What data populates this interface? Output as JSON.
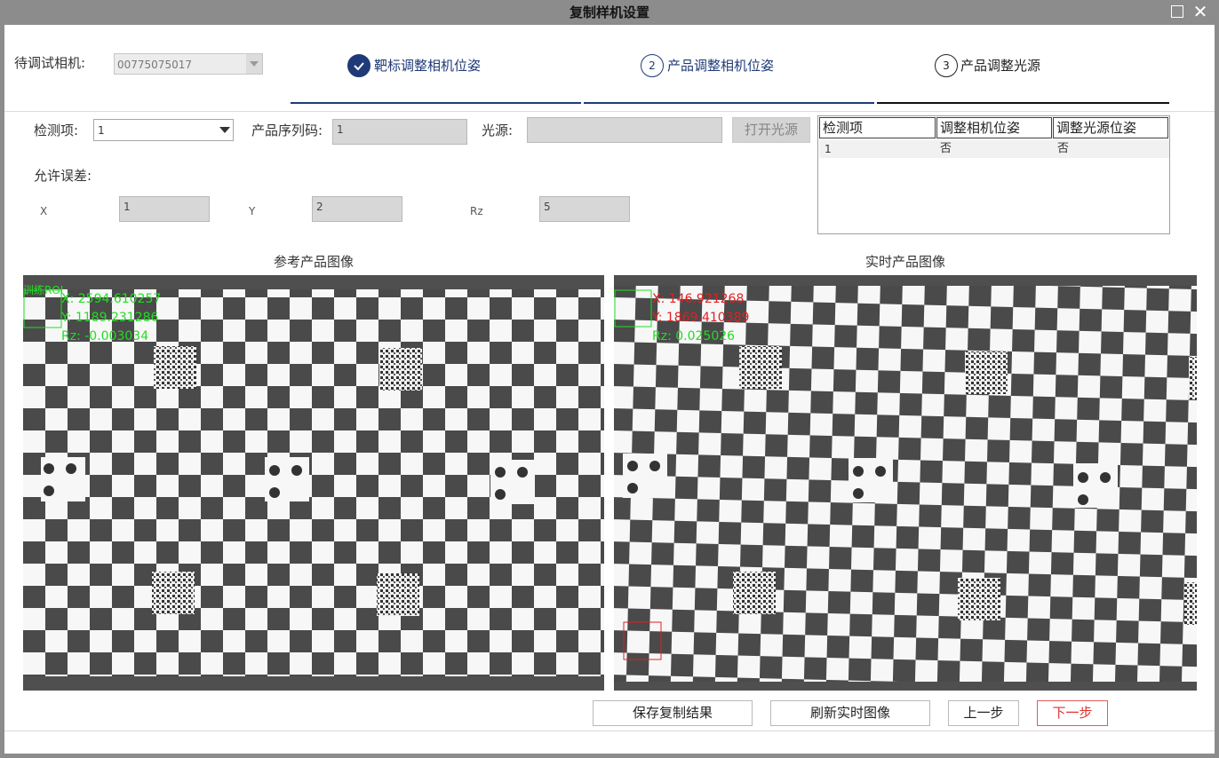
{
  "window": {
    "title": "复制样机设置"
  },
  "camera": {
    "label": "待调试相机:",
    "value": "00775075017"
  },
  "steps": [
    {
      "num": "✓",
      "label": "靶标调整相机位姿",
      "state": "done",
      "color": "#1f3a78"
    },
    {
      "num": "2",
      "label": "产品调整相机位姿",
      "state": "pending",
      "color": "#1f3a78"
    },
    {
      "num": "3",
      "label": "产品调整光源",
      "state": "pending",
      "color": "#222222"
    }
  ],
  "form": {
    "detect_label": "检测项:",
    "detect_value": "1",
    "serial_label": "产品序列码:",
    "serial_value": "1",
    "light_label": "光源:",
    "light_value": "",
    "open_light_button": "打开光源",
    "tolerance_label": "允许误差:",
    "x_label": "X",
    "x_value": "1",
    "y_label": "Y",
    "y_value": "2",
    "rz_label": "Rz",
    "rz_value": "5"
  },
  "table": {
    "columns": [
      "检测项",
      "调整相机位姿",
      "调整光源位姿"
    ],
    "rows": [
      [
        "1",
        "否",
        "否"
      ]
    ]
  },
  "reference": {
    "title": "参考产品图像",
    "roi_label": "训练ROI",
    "x": "X: 2594.610257",
    "y": "Y: 1189.231286",
    "rz": "Rz: -0.003034",
    "text_color": "#22dd22"
  },
  "live": {
    "title": "实时产品图像",
    "x": "X: 146.921268",
    "y": "Y: 1869.410389",
    "rz": "Rz: 0.025026",
    "xy_color": "#e02020",
    "rz_color": "#22dd22"
  },
  "buttons": {
    "save": "保存复制结果",
    "refresh": "刷新实时图像",
    "prev": "上一步",
    "next": "下一步"
  }
}
